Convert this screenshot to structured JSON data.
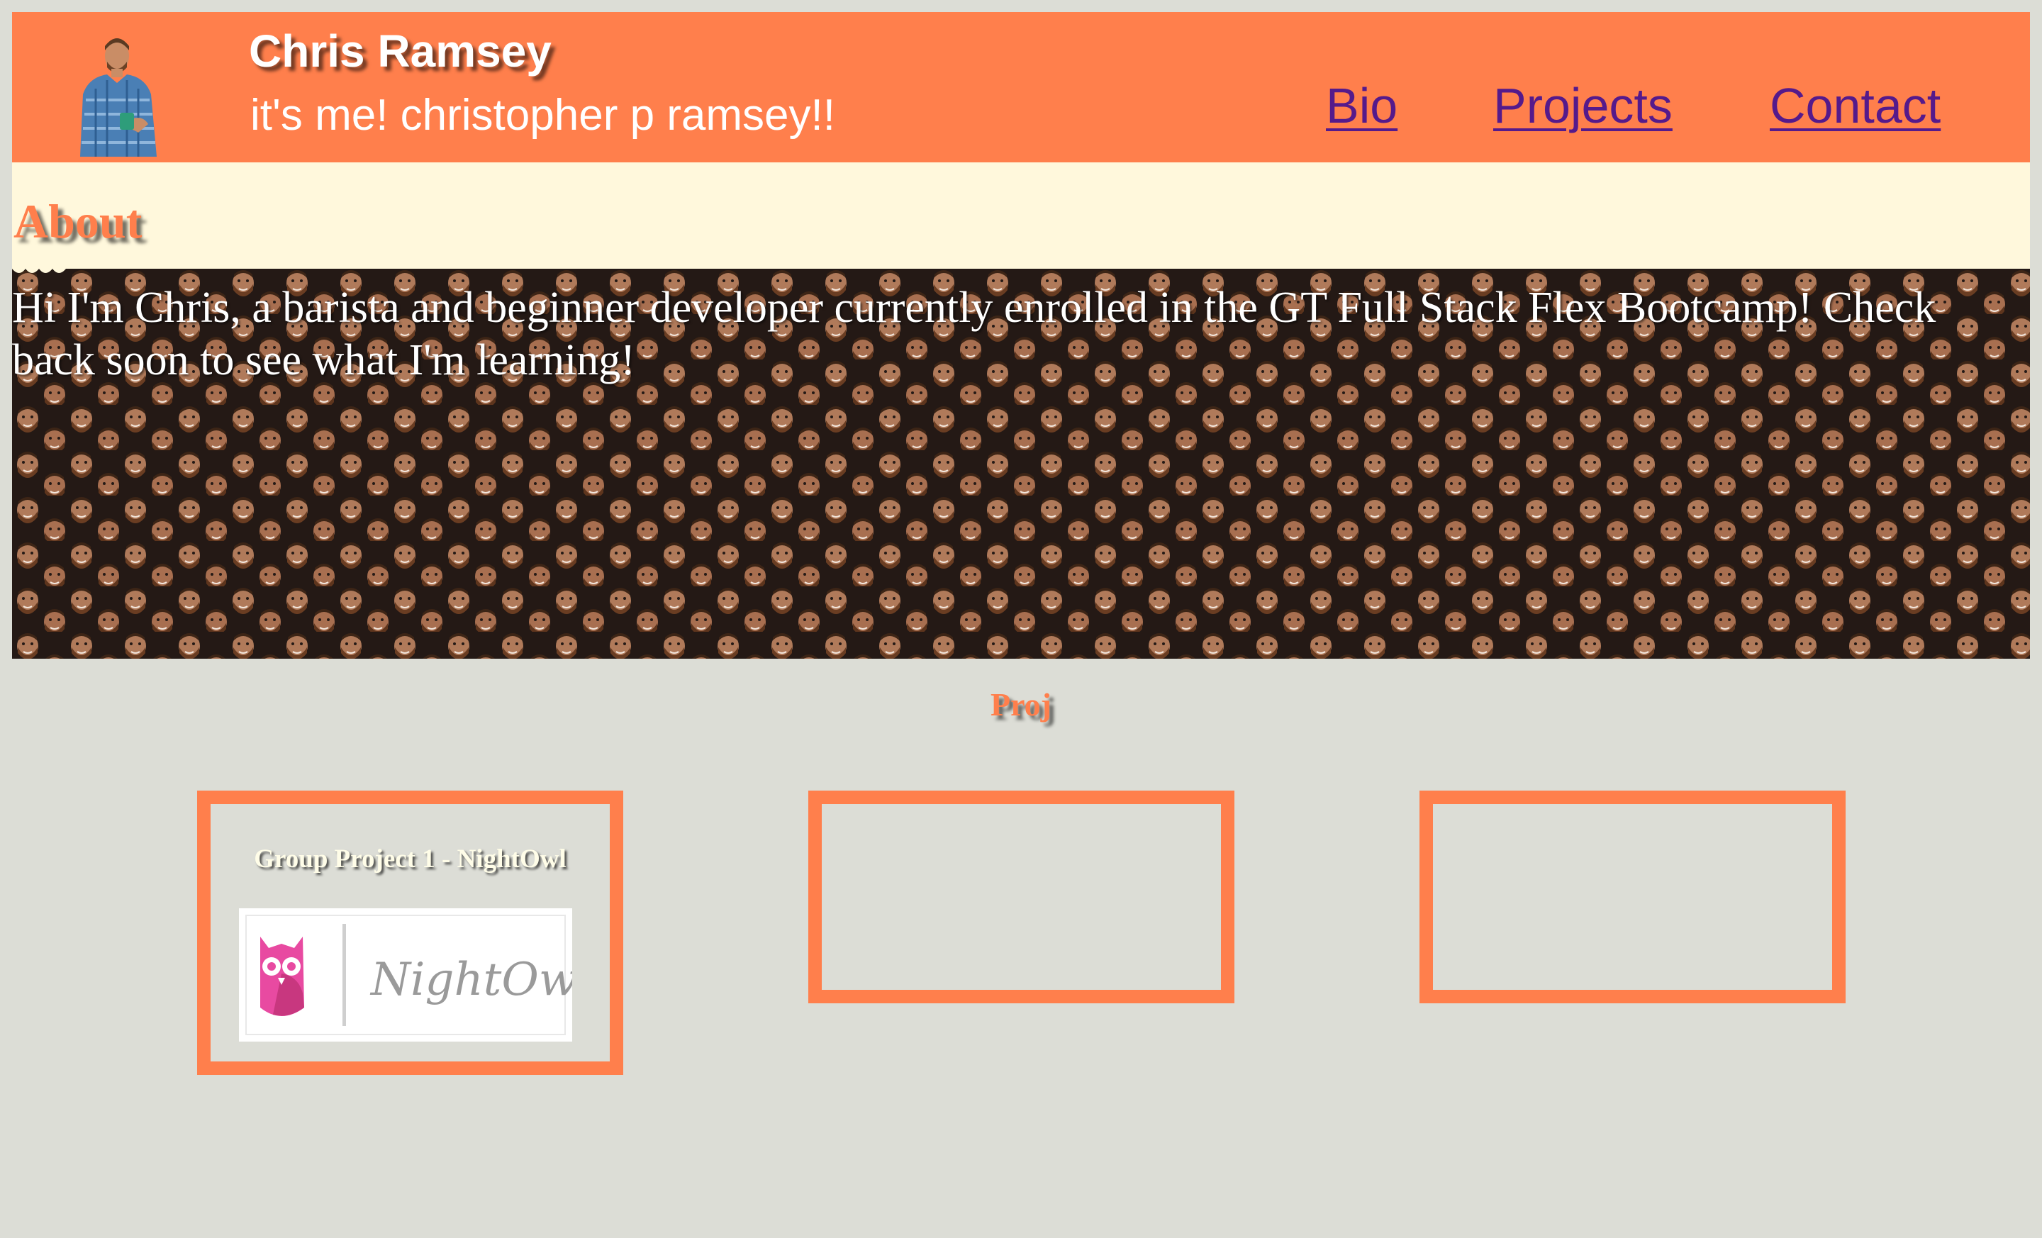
{
  "header": {
    "name": "Chris Ramsey",
    "tagline": "it's me! christopher p ramsey!!",
    "avatar_icon": "person-holding-mug-photo",
    "accent_color": "#ff7f4c"
  },
  "nav": {
    "items": [
      {
        "label": "Bio"
      },
      {
        "label": "Projects"
      },
      {
        "label": "Contact"
      }
    ],
    "link_color": "#551a8b"
  },
  "about": {
    "heading": "About",
    "text": "Hi I'm Chris, a barista and beginner developer currently enrolled in the GT Full Stack Flex Bootcamp! Check back soon to see what I'm learning!",
    "background_color": "#fff8dc",
    "background_pattern_icon": "repeating-face-photo-pattern"
  },
  "projects": {
    "heading": "Proj",
    "cards": [
      {
        "title": "Group Project 1 - NightOwl",
        "logo_icon": "nightowl-logo-icon",
        "logo_text": "NightOwl"
      },
      {
        "title": ""
      },
      {
        "title": ""
      }
    ]
  },
  "page_background": "#dcddd6"
}
